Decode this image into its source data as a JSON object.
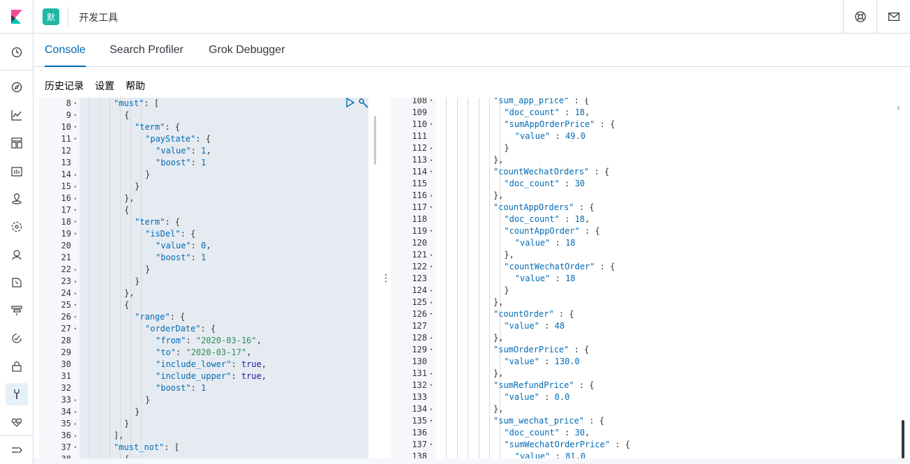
{
  "header": {
    "space_badge": "默",
    "app_title": "开发工具",
    "help_icon": "lifebuoy-icon",
    "mail_icon": "mail-icon"
  },
  "sidenav": {
    "items": [
      "clock-icon",
      "compass-icon",
      "visualize-icon",
      "dashboard-icon",
      "canvas-icon",
      "maps-icon",
      "ml-icon",
      "infra-icon",
      "logs-icon",
      "apm-icon",
      "uptime-icon",
      "security-icon",
      "devtools-icon",
      "monitoring-icon",
      "collapse-icon"
    ]
  },
  "tabs": [
    {
      "label": "Console",
      "active": true
    },
    {
      "label": "Search Profiler",
      "active": false
    },
    {
      "label": "Grok Debugger",
      "active": false
    }
  ],
  "submenu": {
    "history": "历史记录",
    "settings": "设置",
    "help": "帮助"
  },
  "left_editor": {
    "lines": [
      {
        "n": "8",
        "fold": "▾",
        "indent": 3,
        "tokens": [
          [
            "k",
            "\"must\""
          ],
          [
            "p",
            ": ["
          ]
        ]
      },
      {
        "n": "9",
        "fold": "▾",
        "indent": 4,
        "tokens": [
          [
            "p",
            "{"
          ]
        ]
      },
      {
        "n": "10",
        "fold": "▾",
        "indent": 5,
        "tokens": [
          [
            "k",
            "\"term\""
          ],
          [
            "p",
            ": {"
          ]
        ]
      },
      {
        "n": "11",
        "fold": "▾",
        "indent": 6,
        "tokens": [
          [
            "k",
            "\"payState\""
          ],
          [
            "p",
            ": {"
          ]
        ]
      },
      {
        "n": "12",
        "fold": "",
        "indent": 7,
        "tokens": [
          [
            "k",
            "\"value\""
          ],
          [
            "p",
            ": "
          ],
          [
            "n",
            "1"
          ],
          [
            "p",
            ","
          ]
        ]
      },
      {
        "n": "13",
        "fold": "",
        "indent": 7,
        "tokens": [
          [
            "k",
            "\"boost\""
          ],
          [
            "p",
            ": "
          ],
          [
            "n",
            "1"
          ]
        ]
      },
      {
        "n": "14",
        "fold": "▴",
        "indent": 6,
        "tokens": [
          [
            "p",
            "}"
          ]
        ]
      },
      {
        "n": "15",
        "fold": "▴",
        "indent": 5,
        "tokens": [
          [
            "p",
            "}"
          ]
        ]
      },
      {
        "n": "16",
        "fold": "▴",
        "indent": 4,
        "tokens": [
          [
            "p",
            "},"
          ]
        ]
      },
      {
        "n": "17",
        "fold": "▾",
        "indent": 4,
        "tokens": [
          [
            "p",
            "{"
          ]
        ]
      },
      {
        "n": "18",
        "fold": "▾",
        "indent": 5,
        "tokens": [
          [
            "k",
            "\"term\""
          ],
          [
            "p",
            ": {"
          ]
        ]
      },
      {
        "n": "19",
        "fold": "▾",
        "indent": 6,
        "tokens": [
          [
            "k",
            "\"isDel\""
          ],
          [
            "p",
            ": {"
          ]
        ]
      },
      {
        "n": "20",
        "fold": "",
        "indent": 7,
        "tokens": [
          [
            "k",
            "\"value\""
          ],
          [
            "p",
            ": "
          ],
          [
            "n",
            "0"
          ],
          [
            "p",
            ","
          ]
        ]
      },
      {
        "n": "21",
        "fold": "",
        "indent": 7,
        "tokens": [
          [
            "k",
            "\"boost\""
          ],
          [
            "p",
            ": "
          ],
          [
            "n",
            "1"
          ]
        ]
      },
      {
        "n": "22",
        "fold": "▴",
        "indent": 6,
        "tokens": [
          [
            "p",
            "}"
          ]
        ]
      },
      {
        "n": "23",
        "fold": "▴",
        "indent": 5,
        "tokens": [
          [
            "p",
            "}"
          ]
        ]
      },
      {
        "n": "24",
        "fold": "▴",
        "indent": 4,
        "tokens": [
          [
            "p",
            "},"
          ]
        ]
      },
      {
        "n": "25",
        "fold": "▾",
        "indent": 4,
        "tokens": [
          [
            "p",
            "{"
          ]
        ]
      },
      {
        "n": "26",
        "fold": "▾",
        "indent": 5,
        "tokens": [
          [
            "k",
            "\"range\""
          ],
          [
            "p",
            ": {"
          ]
        ]
      },
      {
        "n": "27",
        "fold": "▾",
        "indent": 6,
        "tokens": [
          [
            "k",
            "\"orderDate\""
          ],
          [
            "p",
            ": {"
          ]
        ]
      },
      {
        "n": "28",
        "fold": "",
        "indent": 7,
        "tokens": [
          [
            "k",
            "\"from\""
          ],
          [
            "p",
            ": "
          ],
          [
            "s",
            "\"2020-03-16\""
          ],
          [
            "p",
            ","
          ]
        ]
      },
      {
        "n": "29",
        "fold": "",
        "indent": 7,
        "tokens": [
          [
            "k",
            "\"to\""
          ],
          [
            "p",
            ": "
          ],
          [
            "s",
            "\"2020-03-17\""
          ],
          [
            "p",
            ","
          ]
        ]
      },
      {
        "n": "30",
        "fold": "",
        "indent": 7,
        "tokens": [
          [
            "k",
            "\"include_lower\""
          ],
          [
            "p",
            ": "
          ],
          [
            "b",
            "true"
          ],
          [
            "p",
            ","
          ]
        ]
      },
      {
        "n": "31",
        "fold": "",
        "indent": 7,
        "tokens": [
          [
            "k",
            "\"include_upper\""
          ],
          [
            "p",
            ": "
          ],
          [
            "b",
            "true"
          ],
          [
            "p",
            ","
          ]
        ]
      },
      {
        "n": "32",
        "fold": "",
        "indent": 7,
        "tokens": [
          [
            "k",
            "\"boost\""
          ],
          [
            "p",
            ": "
          ],
          [
            "n",
            "1"
          ]
        ]
      },
      {
        "n": "33",
        "fold": "▴",
        "indent": 6,
        "tokens": [
          [
            "p",
            "}"
          ]
        ]
      },
      {
        "n": "34",
        "fold": "▴",
        "indent": 5,
        "tokens": [
          [
            "p",
            "}"
          ]
        ]
      },
      {
        "n": "35",
        "fold": "▴",
        "indent": 4,
        "tokens": [
          [
            "p",
            "}"
          ]
        ]
      },
      {
        "n": "36",
        "fold": "▴",
        "indent": 3,
        "tokens": [
          [
            "p",
            "],"
          ]
        ]
      },
      {
        "n": "37",
        "fold": "▾",
        "indent": 3,
        "tokens": [
          [
            "k",
            "\"must_not\""
          ],
          [
            "p",
            ": ["
          ]
        ]
      },
      {
        "n": "38",
        "fold": "",
        "indent": 4,
        "tokens": [
          [
            "p",
            "{"
          ]
        ]
      }
    ]
  },
  "right_editor": {
    "lines": [
      {
        "n": "108",
        "fold": "▾",
        "indent": 5,
        "tokens": [
          [
            "k",
            "\"sum_app_price\""
          ],
          [
            "p",
            " : {"
          ]
        ]
      },
      {
        "n": "109",
        "fold": "",
        "indent": 6,
        "tokens": [
          [
            "k",
            "\"doc_count\""
          ],
          [
            "p",
            " : "
          ],
          [
            "n",
            "18"
          ],
          [
            "p",
            ","
          ]
        ]
      },
      {
        "n": "110",
        "fold": "▾",
        "indent": 6,
        "tokens": [
          [
            "k",
            "\"sumAppOrderPrice\""
          ],
          [
            "p",
            " : {"
          ]
        ]
      },
      {
        "n": "111",
        "fold": "",
        "indent": 7,
        "tokens": [
          [
            "k",
            "\"value\""
          ],
          [
            "p",
            " : "
          ],
          [
            "n",
            "49.0"
          ]
        ]
      },
      {
        "n": "112",
        "fold": "▴",
        "indent": 6,
        "tokens": [
          [
            "p",
            "}"
          ]
        ]
      },
      {
        "n": "113",
        "fold": "▴",
        "indent": 5,
        "tokens": [
          [
            "p",
            "},"
          ]
        ]
      },
      {
        "n": "114",
        "fold": "▾",
        "indent": 5,
        "tokens": [
          [
            "k",
            "\"countWechatOrders\""
          ],
          [
            "p",
            " : {"
          ]
        ]
      },
      {
        "n": "115",
        "fold": "",
        "indent": 6,
        "tokens": [
          [
            "k",
            "\"doc_count\""
          ],
          [
            "p",
            " : "
          ],
          [
            "n",
            "30"
          ]
        ]
      },
      {
        "n": "116",
        "fold": "▴",
        "indent": 5,
        "tokens": [
          [
            "p",
            "},"
          ]
        ]
      },
      {
        "n": "117",
        "fold": "▾",
        "indent": 5,
        "tokens": [
          [
            "k",
            "\"countAppOrders\""
          ],
          [
            "p",
            " : {"
          ]
        ]
      },
      {
        "n": "118",
        "fold": "",
        "indent": 6,
        "tokens": [
          [
            "k",
            "\"doc_count\""
          ],
          [
            "p",
            " : "
          ],
          [
            "n",
            "18"
          ],
          [
            "p",
            ","
          ]
        ]
      },
      {
        "n": "119",
        "fold": "▾",
        "indent": 6,
        "tokens": [
          [
            "k",
            "\"countAppOrder\""
          ],
          [
            "p",
            " : {"
          ]
        ]
      },
      {
        "n": "120",
        "fold": "",
        "indent": 7,
        "tokens": [
          [
            "k",
            "\"value\""
          ],
          [
            "p",
            " : "
          ],
          [
            "n",
            "18"
          ]
        ]
      },
      {
        "n": "121",
        "fold": "▴",
        "indent": 6,
        "tokens": [
          [
            "p",
            "},"
          ]
        ]
      },
      {
        "n": "122",
        "fold": "▾",
        "indent": 6,
        "tokens": [
          [
            "k",
            "\"countWechatOrder\""
          ],
          [
            "p",
            " : {"
          ]
        ]
      },
      {
        "n": "123",
        "fold": "",
        "indent": 7,
        "tokens": [
          [
            "k",
            "\"value\""
          ],
          [
            "p",
            " : "
          ],
          [
            "n",
            "18"
          ]
        ]
      },
      {
        "n": "124",
        "fold": "▴",
        "indent": 6,
        "tokens": [
          [
            "p",
            "}"
          ]
        ]
      },
      {
        "n": "125",
        "fold": "▴",
        "indent": 5,
        "tokens": [
          [
            "p",
            "},"
          ]
        ]
      },
      {
        "n": "126",
        "fold": "▾",
        "indent": 5,
        "tokens": [
          [
            "k",
            "\"countOrder\""
          ],
          [
            "p",
            " : {"
          ]
        ]
      },
      {
        "n": "127",
        "fold": "",
        "indent": 6,
        "tokens": [
          [
            "k",
            "\"value\""
          ],
          [
            "p",
            " : "
          ],
          [
            "n",
            "48"
          ]
        ]
      },
      {
        "n": "128",
        "fold": "▴",
        "indent": 5,
        "tokens": [
          [
            "p",
            "},"
          ]
        ]
      },
      {
        "n": "129",
        "fold": "▾",
        "indent": 5,
        "tokens": [
          [
            "k",
            "\"sumOrderPrice\""
          ],
          [
            "p",
            " : {"
          ]
        ]
      },
      {
        "n": "130",
        "fold": "",
        "indent": 6,
        "tokens": [
          [
            "k",
            "\"value\""
          ],
          [
            "p",
            " : "
          ],
          [
            "n",
            "130.0"
          ]
        ]
      },
      {
        "n": "131",
        "fold": "▴",
        "indent": 5,
        "tokens": [
          [
            "p",
            "},"
          ]
        ]
      },
      {
        "n": "132",
        "fold": "▾",
        "indent": 5,
        "tokens": [
          [
            "k",
            "\"sumRefundPrice\""
          ],
          [
            "p",
            " : {"
          ]
        ]
      },
      {
        "n": "133",
        "fold": "",
        "indent": 6,
        "tokens": [
          [
            "k",
            "\"value\""
          ],
          [
            "p",
            " : "
          ],
          [
            "n",
            "0.0"
          ]
        ]
      },
      {
        "n": "134",
        "fold": "▴",
        "indent": 5,
        "tokens": [
          [
            "p",
            "},"
          ]
        ]
      },
      {
        "n": "135",
        "fold": "▾",
        "indent": 5,
        "tokens": [
          [
            "k",
            "\"sum_wechat_price\""
          ],
          [
            "p",
            " : {"
          ]
        ]
      },
      {
        "n": "136",
        "fold": "",
        "indent": 6,
        "tokens": [
          [
            "k",
            "\"doc_count\""
          ],
          [
            "p",
            " : "
          ],
          [
            "n",
            "30"
          ],
          [
            "p",
            ","
          ]
        ]
      },
      {
        "n": "137",
        "fold": "▾",
        "indent": 6,
        "tokens": [
          [
            "k",
            "\"sumWechatOrderPrice\""
          ],
          [
            "p",
            " : {"
          ]
        ]
      },
      {
        "n": "138",
        "fold": "",
        "indent": 7,
        "tokens": [
          [
            "k",
            "\"value\""
          ],
          [
            "p",
            " : "
          ],
          [
            "n",
            "81.0"
          ]
        ]
      }
    ]
  },
  "colors": {
    "accent": "#006bb4",
    "badge": "#20b7a3",
    "highlight": "#e6ebf2"
  }
}
